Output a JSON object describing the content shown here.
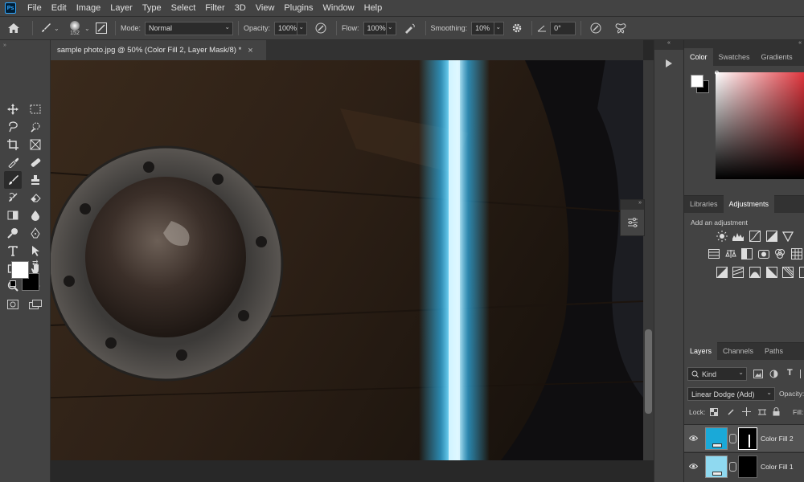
{
  "app_icon": "Ps",
  "menu": [
    "File",
    "Edit",
    "Image",
    "Layer",
    "Type",
    "Select",
    "Filter",
    "3D",
    "View",
    "Plugins",
    "Window",
    "Help"
  ],
  "options": {
    "brush_size": "152",
    "mode_label": "Mode:",
    "mode_value": "Normal",
    "opacity_label": "Opacity:",
    "opacity_value": "100%",
    "flow_label": "Flow:",
    "flow_value": "100%",
    "smoothing_label": "Smoothing:",
    "smoothing_value": "10%",
    "angle_value": "0°"
  },
  "document": {
    "tab_title": "sample photo.jpg @ 50% (Color Fill 2, Layer Mask/8) *",
    "close_glyph": "×"
  },
  "color_panel": {
    "tabs": [
      "Color",
      "Swatches",
      "Gradients"
    ],
    "active_tab": "Color"
  },
  "adjustments_panel": {
    "tabs": [
      "Libraries",
      "Adjustments"
    ],
    "active_tab": "Adjustments",
    "hint": "Add an adjustment"
  },
  "layers_panel": {
    "tabs": [
      "Layers",
      "Channels",
      "Paths"
    ],
    "active_tab": "Layers",
    "filter_kind": "Kind",
    "blend_mode": "Linear Dodge (Add)",
    "opacity_label": "Opacity:",
    "lock_label": "Lock:",
    "fill_label": "Fill:",
    "layers": [
      {
        "name": "Color Fill 2",
        "swatch": "#1aa9d8",
        "selected": true
      },
      {
        "name": "Color Fill 1",
        "swatch": "#8fd9f0",
        "selected": false
      }
    ]
  },
  "colors": {
    "foreground": "#ffffff",
    "background": "#000000",
    "glow": "#3ec8ff"
  }
}
